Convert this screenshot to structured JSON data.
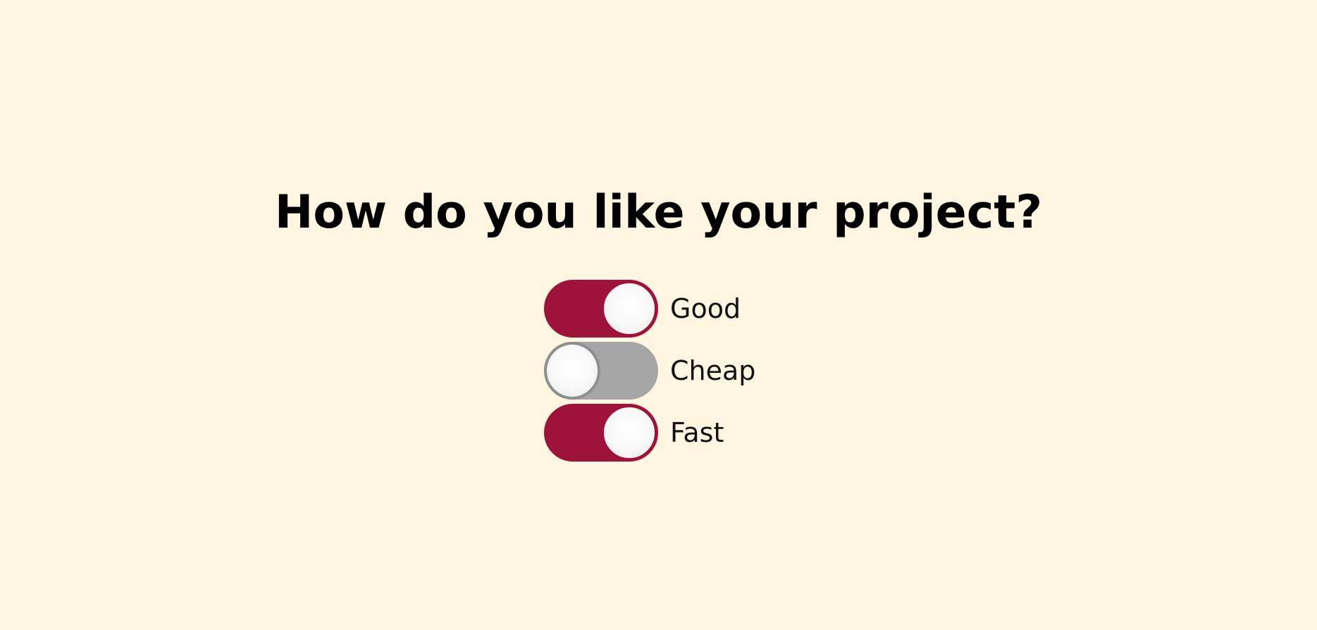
{
  "title": "How do you like your project?",
  "options": [
    {
      "label": "Good",
      "checked": true
    },
    {
      "label": "Cheap",
      "checked": false
    },
    {
      "label": "Fast",
      "checked": true
    }
  ],
  "colors": {
    "background": "#fff5e1",
    "toggle_on": "#9e1339",
    "toggle_off": "#a6a6a6",
    "knob": "#f8f8f8"
  }
}
